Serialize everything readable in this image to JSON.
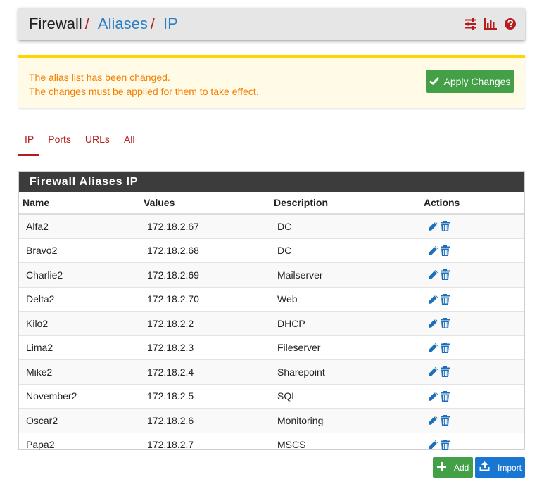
{
  "header": {
    "breadcrumb_root": "Firewall",
    "breadcrumb_sep": "/",
    "breadcrumb_items": [
      "Aliases",
      "IP"
    ],
    "icons": [
      "sliders-icon",
      "bar-chart-icon",
      "help-icon"
    ]
  },
  "alert": {
    "line1": "The alias list has been changed.",
    "line2": "The changes must be applied for them to take effect.",
    "apply_label": "Apply Changes"
  },
  "tabs": [
    {
      "label": "IP",
      "active": true
    },
    {
      "label": "Ports",
      "active": false
    },
    {
      "label": "URLs",
      "active": false
    },
    {
      "label": "All",
      "active": false
    }
  ],
  "panel": {
    "title": "Firewall Aliases IP",
    "columns": [
      "Name",
      "Values",
      "Description",
      "Actions"
    ],
    "rows": [
      {
        "name": "Alfa2",
        "value": "172.18.2.67",
        "description": "DC"
      },
      {
        "name": "Bravo2",
        "value": "172.18.2.68",
        "description": "DC"
      },
      {
        "name": "Charlie2",
        "value": "172.18.2.69",
        "description": "Mailserver"
      },
      {
        "name": "Delta2",
        "value": "172.18.2.70",
        "description": "Web"
      },
      {
        "name": "Kilo2",
        "value": "172.18.2.2",
        "description": "DHCP"
      },
      {
        "name": "Lima2",
        "value": "172.18.2.3",
        "description": "Fileserver"
      },
      {
        "name": "Mike2",
        "value": "172.18.2.4",
        "description": "Sharepoint"
      },
      {
        "name": "November2",
        "value": "172.18.2.5",
        "description": "SQL"
      },
      {
        "name": "Oscar2",
        "value": "172.18.2.6",
        "description": "Monitoring"
      },
      {
        "name": "Papa2",
        "value": "172.18.2.7",
        "description": "MSCS"
      }
    ]
  },
  "buttons": {
    "add_label": "Add",
    "import_label": "Import"
  },
  "colors": {
    "accent_red": "#b71c1c",
    "link_blue": "#2c7ec4",
    "success_green": "#43a047",
    "primary_blue": "#1976d2",
    "warning_orange": "#f57c00"
  }
}
